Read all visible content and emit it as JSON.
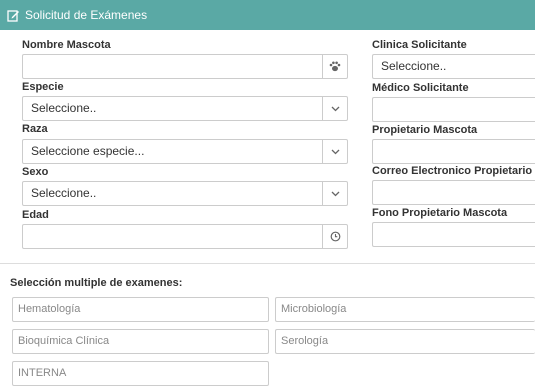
{
  "header": {
    "title": "Solicitud de Exámenes",
    "icon": "edit-icon",
    "color": "#5aa9a5"
  },
  "left": {
    "nombre_mascota": {
      "label": "Nombre Mascota",
      "value": "",
      "icon": "paw-icon"
    },
    "especie": {
      "label": "Especie",
      "value": "Seleccione..",
      "icon": "chevron-down-icon"
    },
    "raza": {
      "label": "Raza",
      "value": "Seleccione especie...",
      "icon": "chevron-down-icon"
    },
    "sexo": {
      "label": "Sexo",
      "value": "Seleccione..",
      "icon": "chevron-down-icon"
    },
    "edad": {
      "label": "Edad",
      "value": "",
      "icon": "clock-icon"
    }
  },
  "right": {
    "clinica": {
      "label": "Clinica Solicitante",
      "value": "Seleccione.."
    },
    "medico": {
      "label": "Médico Solicitante",
      "value": ""
    },
    "propietario": {
      "label": "Propietario Mascota",
      "value": ""
    },
    "correo": {
      "label": "Correo Electronico Propietario",
      "value": ""
    },
    "fono": {
      "label": "Fono Propietario Mascota",
      "value": ""
    }
  },
  "exams": {
    "title": "Selección multiple de examenes:",
    "items": [
      "Hematología",
      "Microbiología",
      "Bioquímica Clínica",
      "Serología",
      "INTERNA"
    ]
  }
}
